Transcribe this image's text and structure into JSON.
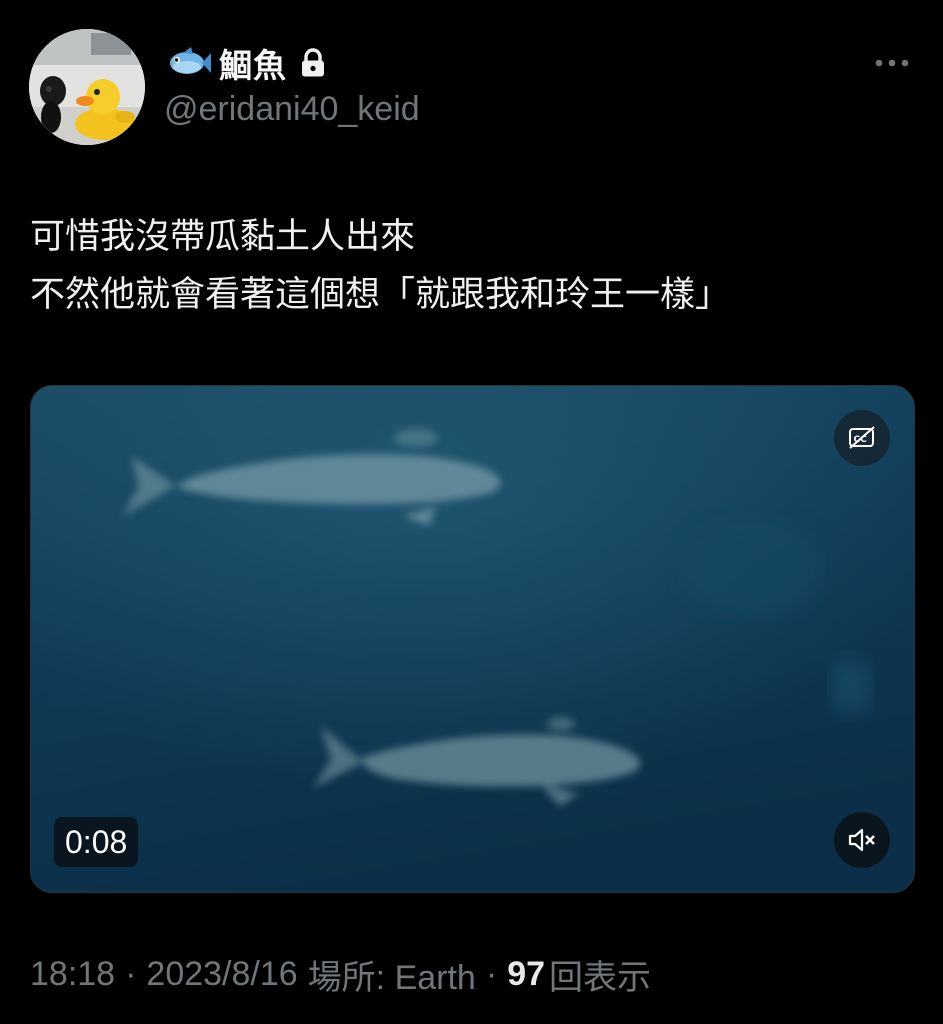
{
  "author": {
    "display_name": "鯝魚",
    "handle": "@eridani40_keid",
    "icons": [
      "fish-emoji",
      "lock-icon"
    ]
  },
  "header": {
    "more_icon": "more-horizontal-icon"
  },
  "tweet": {
    "lines": [
      "可惜我沒帶瓜黏土人出來",
      "不然他就會看著這個想「就跟我和玲王一樣」"
    ]
  },
  "video": {
    "duration": "0:08",
    "cc_icon": "captions-off-icon",
    "mute_icon": "speaker-muted-icon",
    "muted": true
  },
  "meta": {
    "time": "18:18",
    "separator": "·",
    "date": "2023/8/16",
    "location": "場所: Earth",
    "views_count": "97",
    "views_label": "回表示"
  },
  "colors": {
    "background": "#000000",
    "primary_text": "#e7e9ea",
    "secondary_text": "#71767b",
    "video_water": "#0f3a54"
  }
}
